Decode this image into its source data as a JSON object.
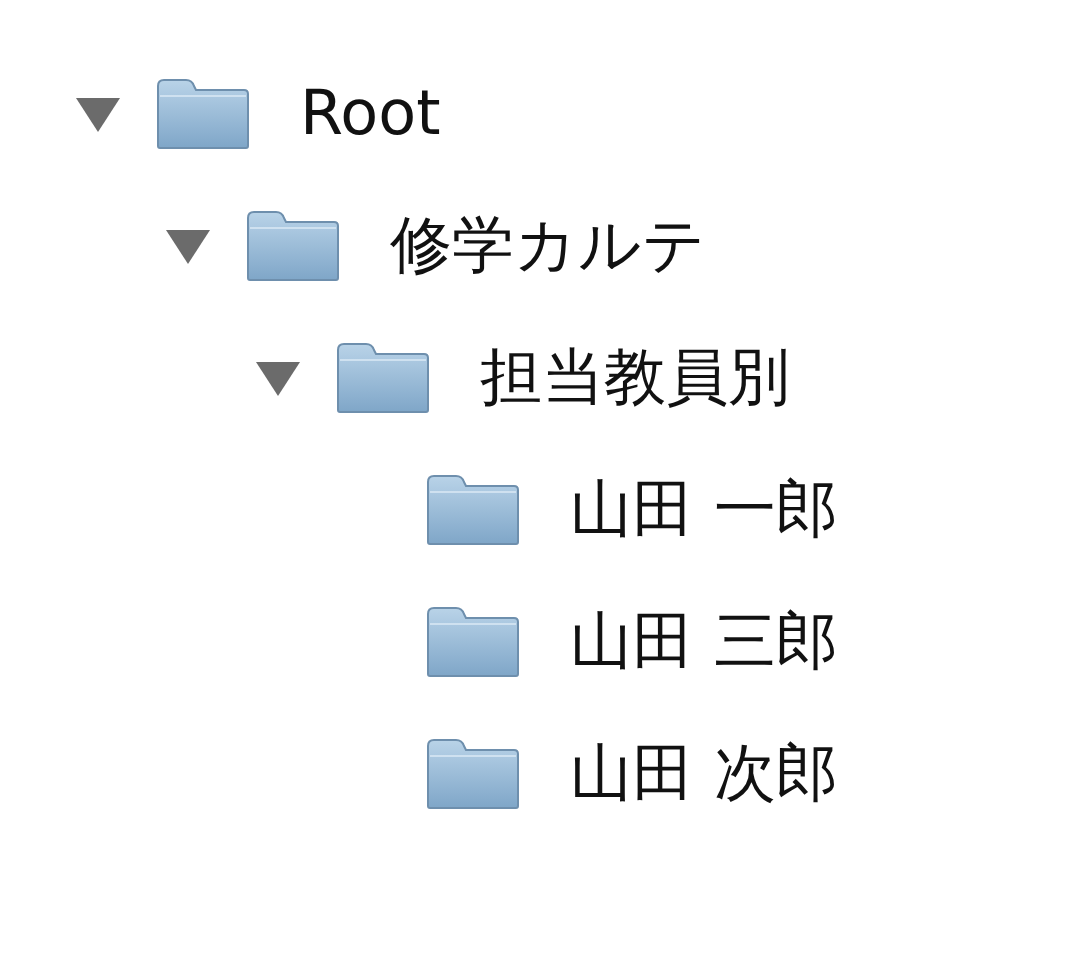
{
  "tree": [
    {
      "label": "Root",
      "expanded": true,
      "children": [
        {
          "label": "修学カルテ",
          "expanded": true,
          "children": [
            {
              "label": "担当教員別",
              "expanded": true,
              "children": [
                {
                  "label": "山田 一郎"
                },
                {
                  "label": "山田 三郎"
                },
                {
                  "label": "山田 次郎"
                }
              ]
            }
          ]
        }
      ]
    }
  ]
}
